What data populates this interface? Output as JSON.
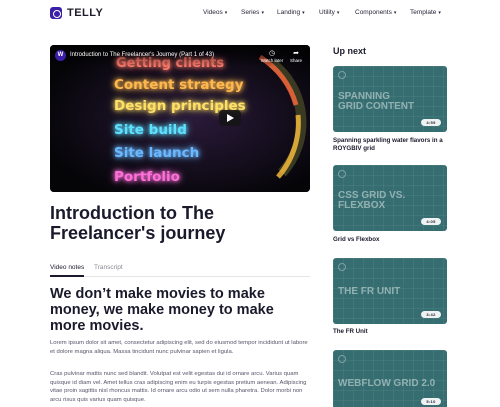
{
  "brand": {
    "name": "TELLY"
  },
  "nav": {
    "items": [
      {
        "label": "Videos"
      },
      {
        "label": "Series"
      },
      {
        "label": "Landing"
      },
      {
        "label": "Utility"
      },
      {
        "label": "Components"
      },
      {
        "label": "Template"
      }
    ],
    "chevron": "▾"
  },
  "player": {
    "channel_initial": "W",
    "title": "Introduction to The Freelancer's Journey (Part 1 of 43)",
    "watch_later_label": "Watch later",
    "share_label": "Share",
    "watch_later_icon": "clock-icon",
    "share_icon": "share-icon",
    "play_icon": "play-icon",
    "neon_words": [
      "Getting clients",
      "Content strategy",
      "Design principles",
      "Site build",
      "Site launch",
      "Portfolio"
    ],
    "neon_colors": [
      "#ff7a6b",
      "#ffb84d",
      "#ffe066",
      "#5ee0ff",
      "#6ab8ff",
      "#ff6fd8"
    ]
  },
  "article": {
    "title": "Introduction to The Freelancer's journey",
    "tabs": [
      {
        "label": "Video notes",
        "active": true
      },
      {
        "label": "Transcript",
        "active": false
      }
    ],
    "heading": "We don’t make movies to make money, we make money to make more movies.",
    "paragraphs": [
      "Lorem ipsum dolor sit amet, consectetur adipiscing elit, sed do eiusmod tempor incididunt ut labore et dolore magna aliqua. Massa tincidunt nunc pulvinar sapien et ligula.",
      "Cras pulvinar mattis nunc sed blandit. Volutpat est velit egestas dui id ornare arcu. Varius quam quisque id diam vel. Amet tellus cras adipiscing enim eu turpis egestas pretium aenean. Adipiscing vitae proin sagittis nisl rhoncus mattis. Id ornare arcu odio ut sem nulla pharetra. Dolor morbi non arcu risus quis varius quam quisque."
    ]
  },
  "sidebar": {
    "heading": "Up next",
    "cards": [
      {
        "thumb_text": [
          "SPANNING",
          "GRID CONTENT"
        ],
        "duration": "4:59",
        "title": "Spanning sparkling water flavors in a ROYGBIV grid"
      },
      {
        "thumb_text": [
          "CSS GRID VS.",
          "FLEXBOX"
        ],
        "duration": "4:05",
        "title": "Grid vs Flexbox"
      },
      {
        "thumb_text": [
          "THE FR UNIT"
        ],
        "duration": "3:42",
        "title": "The FR Unit"
      },
      {
        "thumb_text": [
          "WEBFLOW GRID 2.0"
        ],
        "duration": "5:10",
        "title": ""
      }
    ]
  },
  "colors": {
    "brand": "#3b1fa8",
    "text": "#1a1a2c",
    "muted": "#55556a",
    "card_teal": "#356d70"
  }
}
